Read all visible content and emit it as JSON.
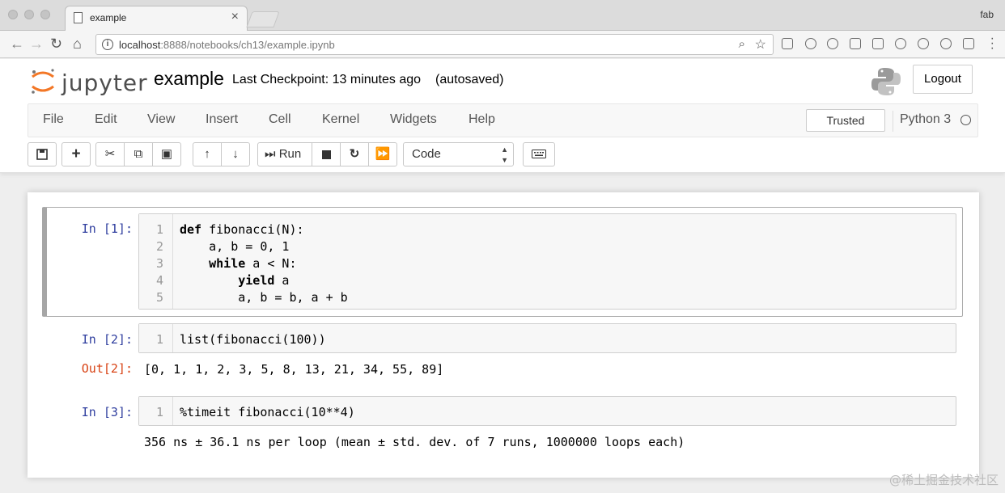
{
  "browser": {
    "tab_title": "example",
    "user": "fab",
    "url_host": "localhost",
    "url_rest": ":8888/notebooks/ch13/example.ipynb"
  },
  "header": {
    "logo_text": "jupyter",
    "notebook_name": "example",
    "checkpoint": "Last Checkpoint: 13 minutes ago",
    "autosave": "(autosaved)",
    "logout_label": "Logout"
  },
  "menubar": {
    "items": [
      "File",
      "Edit",
      "View",
      "Insert",
      "Cell",
      "Kernel",
      "Widgets",
      "Help"
    ],
    "trusted_label": "Trusted",
    "kernel_name": "Python 3"
  },
  "toolbar": {
    "run_label": "Run",
    "cell_type": "Code"
  },
  "cells": [
    {
      "prompt": "In [1]:",
      "line_numbers": [
        "1",
        "2",
        "3",
        "4",
        "5"
      ],
      "lines": [
        "def fibonacci(N):",
        "    a, b = 0, 1",
        "    while a < N:",
        "        yield a",
        "        a, b = b, a + b"
      ]
    },
    {
      "prompt": "In [2]:",
      "line_numbers": [
        "1"
      ],
      "lines": [
        "list(fibonacci(100))"
      ],
      "out_prompt": "Out[2]:",
      "output": "[0, 1, 1, 2, 3, 5, 8, 13, 21, 34, 55, 89]"
    },
    {
      "prompt": "In [3]:",
      "line_numbers": [
        "1"
      ],
      "lines": [
        "%timeit fibonacci(10**4)"
      ],
      "output": "356 ns ± 36.1 ns per loop (mean ± std. dev. of 7 runs, 1000000 loops each)"
    }
  ],
  "watermark": "@稀土掘金技术社区",
  "colors": {
    "in_prompt": "#303f9f",
    "out_prompt": "#d84315",
    "selected_cell_border": "#a6a6a6"
  }
}
